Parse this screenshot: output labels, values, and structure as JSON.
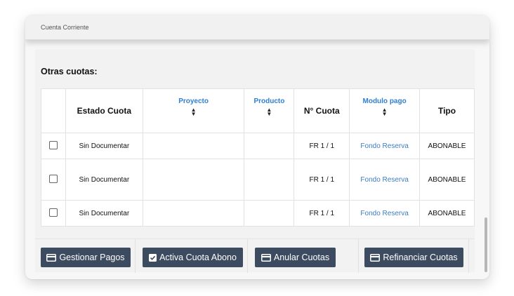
{
  "header": {
    "title": "Cuenta Corriente"
  },
  "section": {
    "title": "Otras cuotas:"
  },
  "table": {
    "columns": [
      "",
      "Estado Cuota",
      "Proyecto",
      "Producto",
      "N° Cuota",
      "Modulo pago",
      "Tipo"
    ],
    "rows": [
      {
        "estado": "Sin Documentar",
        "proyecto": "",
        "producto": "",
        "cuota": "FR 1 / 1",
        "modulo": "Fondo Reserva",
        "tipo": "ABONABLE"
      },
      {
        "estado": "Sin Documentar",
        "proyecto": "",
        "producto": "",
        "cuota": "FR 1 / 1",
        "modulo": "Fondo Reserva",
        "tipo": "ABONABLE"
      },
      {
        "estado": "Sin Documentar",
        "proyecto": "",
        "producto": "",
        "cuota": "FR 1 / 1",
        "modulo": "Fondo Reserva",
        "tipo": "ABONABLE"
      }
    ]
  },
  "buttons": {
    "gestionar": "Gestionar Pagos",
    "activa": "Activa Cuota Abono",
    "anular": "Anular Cuotas",
    "refinanciar": "Refinanciar Cuotas"
  },
  "colors": {
    "button_bg": "#3c4b5f",
    "link": "#3b7dc4",
    "sortable_header": "#2f7fd1"
  },
  "icons": {
    "credit_card": "credit-card-icon",
    "check_square": "check-square-icon",
    "sort": "sort-icon"
  }
}
